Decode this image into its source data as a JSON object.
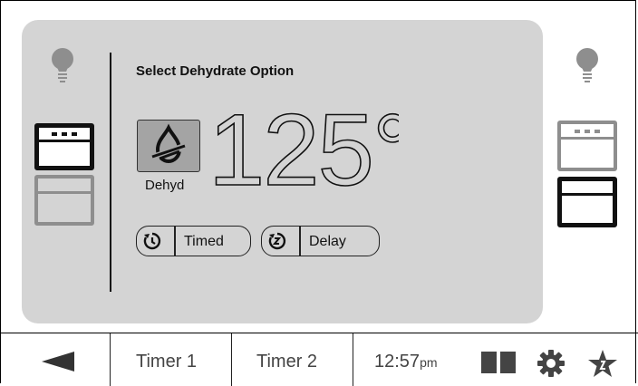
{
  "panel": {
    "title": "Select Dehydrate Option",
    "mode": {
      "label": "Dehyd",
      "icon": "dehydrate-drop-icon"
    },
    "temperature": "125°",
    "options": [
      {
        "label": "Timed",
        "icon": "timer-icon"
      },
      {
        "label": "Delay",
        "icon": "delay-timer-icon"
      }
    ]
  },
  "ovens": {
    "left": {
      "light_icon": "light-bulb-icon",
      "active": "upper"
    },
    "right": {
      "light_icon": "light-bulb-icon",
      "active": "lower"
    }
  },
  "bottom_bar": {
    "back_icon": "back-arrow-icon",
    "timer1": "Timer 1",
    "timer2": "Timer 2",
    "time": "12:57",
    "time_suffix": "pm",
    "icons": [
      "split-view-icon",
      "gear-icon",
      "favorites-star-icon"
    ]
  },
  "colors": {
    "panel_bg": "#d4d4d4",
    "active_border": "#111111",
    "inactive_border": "#8e8e8e",
    "mode_button_bg": "#a4a4a4"
  }
}
